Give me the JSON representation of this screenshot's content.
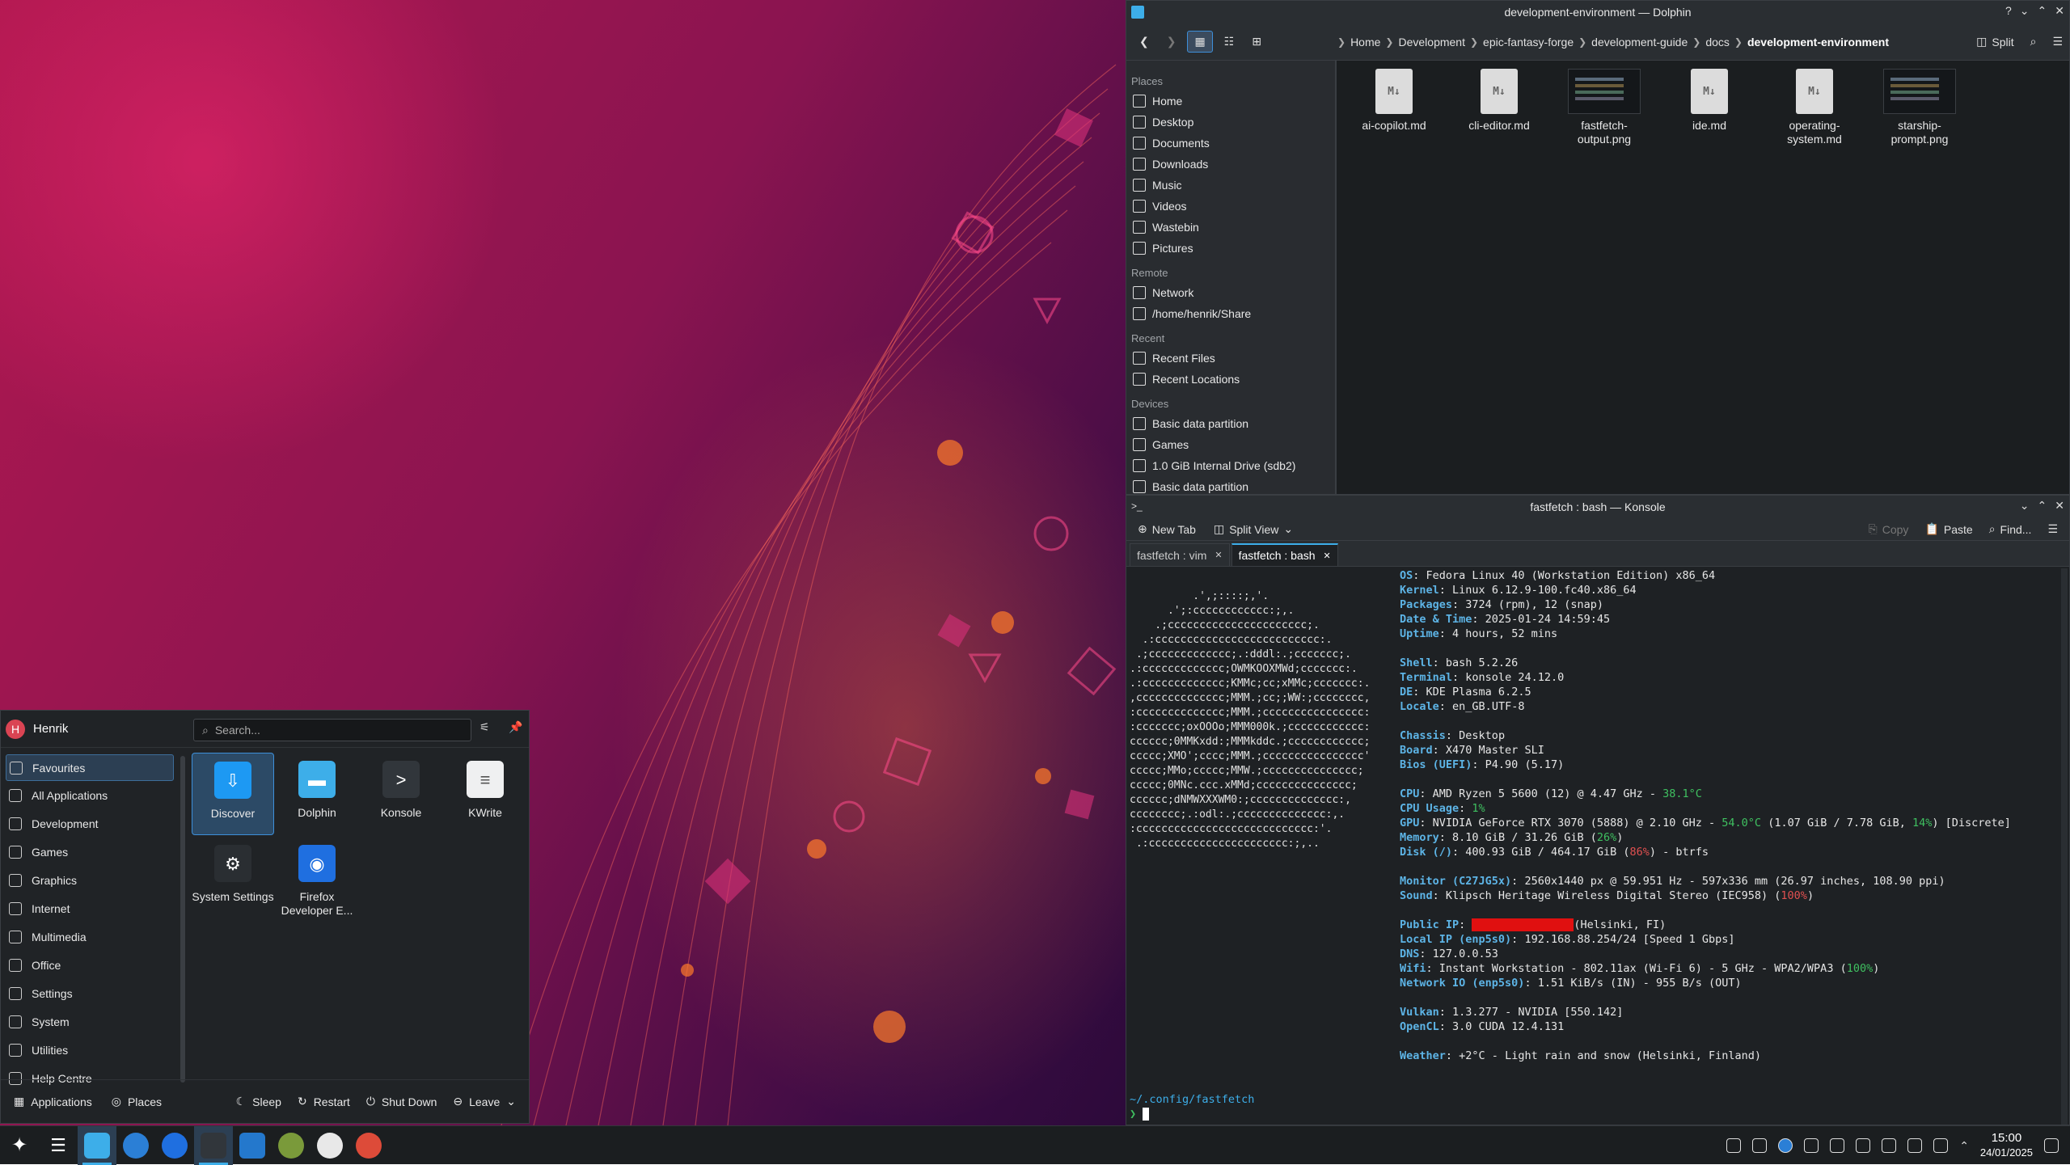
{
  "dolphin": {
    "title": "development-environment — Dolphin",
    "breadcrumb": [
      "Home",
      "Development",
      "epic-fantasy-forge",
      "development-guide",
      "docs",
      "development-environment"
    ],
    "split_label": "Split",
    "places": {
      "section_places": "Places",
      "places": [
        "Home",
        "Desktop",
        "Documents",
        "Downloads",
        "Music",
        "Videos",
        "Wastebin",
        "Pictures"
      ],
      "section_remote": "Remote",
      "remote": [
        "Network",
        "/home/henrik/Share"
      ],
      "section_recent": "Recent",
      "recent": [
        "Recent Files",
        "Recent Locations"
      ],
      "section_devices": "Devices",
      "devices": [
        "Basic data partition",
        "Games",
        "1.0 GiB Internal Drive (sdb2)",
        "Basic data partition"
      ]
    },
    "files": [
      {
        "name": "ai-copilot.md",
        "kind": "md"
      },
      {
        "name": "cli-editor.md",
        "kind": "md"
      },
      {
        "name": "fastfetch-output.png",
        "kind": "png"
      },
      {
        "name": "ide.md",
        "kind": "md"
      },
      {
        "name": "operating-system.md",
        "kind": "md"
      },
      {
        "name": "starship-prompt.png",
        "kind": "png"
      }
    ],
    "md_badge": "M↓"
  },
  "konsole": {
    "title": "fastfetch : bash — Konsole",
    "new_tab": "New Tab",
    "split_view": "Split View",
    "copy": "Copy",
    "paste": "Paste",
    "find": "Find...",
    "tabs": [
      "fastfetch : vim",
      "fastfetch : bash"
    ],
    "ascii": "          .',;::::;,'.\n      .';:cccccccccccc:;,.\n    .;cccccccccccccccccccccc;.\n  .:cccccccccccccccccccccccccc:.\n .;ccccccccccccc;.:dddl:.;ccccccc;.\n.:ccccccccccccc;OWMKOOXMWd;ccccccc:.\n.:ccccccccccccc;KMMc;cc;xMMc;ccccccc:.\n,cccccccccccccc;MMM.;cc;;WW:;cccccccc,\n:cccccccccccccc;MMM.;cccccccccccccccc:\n:ccccccc;oxOOOo;MMM000k.;cccccccccccc:\ncccccc;0MMKxdd:;MMMkddc.;cccccccccccc;\nccccc;XMO';cccc;MMM.;cccccccccccccccc'\nccccc;MMo;ccccc;MMW.;ccccccccccccccc;\nccccc;0MNc.ccc.xMMd;ccccccccccccccc;\ncccccc;dNMWXXXWM0:;cccccccccccccc:,\ncccccccc;.:odl:.;cccccccccccccc:,.\n:cccccccccccccccccccccccccccc:'.\n .:cccccccccccccccccccccc:;,..",
    "info": [
      [
        [
          "k",
          "OS"
        ],
        [
          "",
          "Fedora Linux 40 (Workstation Edition) x86_64"
        ]
      ],
      [
        [
          "k",
          "Kernel"
        ],
        [
          "",
          "Linux 6.12.9-100.fc40.x86_64"
        ]
      ],
      [
        [
          "k",
          "Packages"
        ],
        [
          "",
          "3724 (rpm), 12 (snap)"
        ]
      ],
      [
        [
          "k",
          "Date & Time"
        ],
        [
          "",
          "2025-01-24 14:59:45"
        ]
      ],
      [
        [
          "k",
          "Uptime"
        ],
        [
          "",
          "4 hours, 52 mins"
        ]
      ],
      [],
      [
        [
          "k",
          "Shell"
        ],
        [
          "",
          "bash 5.2.26"
        ]
      ],
      [
        [
          "k",
          "Terminal"
        ],
        [
          "",
          "konsole 24.12.0"
        ]
      ],
      [
        [
          "k",
          "DE"
        ],
        [
          "",
          "KDE Plasma 6.2.5"
        ]
      ],
      [
        [
          "k",
          "Locale"
        ],
        [
          "",
          "en_GB.UTF-8"
        ]
      ],
      [],
      [
        [
          "k",
          "Chassis"
        ],
        [
          "",
          "Desktop"
        ]
      ],
      [
        [
          "k",
          "Board"
        ],
        [
          "",
          "X470 Master SLI"
        ]
      ],
      [
        [
          "k",
          "Bios (UEFI)"
        ],
        [
          "",
          "P4.90 (5.17)"
        ]
      ],
      [],
      [
        [
          "k",
          "CPU"
        ],
        [
          "",
          "AMD Ryzen 5 5600 (12) @ 4.47 GHz - "
        ],
        [
          "g",
          "38.1°C"
        ]
      ],
      [
        [
          "k",
          "CPU Usage"
        ],
        [
          "g",
          "1%"
        ]
      ],
      [
        [
          "k",
          "GPU"
        ],
        [
          "",
          "NVIDIA GeForce RTX 3070 (5888) @ 2.10 GHz - "
        ],
        [
          "g",
          "54.0°C"
        ],
        [
          "",
          " (1.07 GiB / 7.78 GiB, "
        ],
        [
          "g",
          "14%"
        ],
        [
          "",
          ") [Discrete]"
        ]
      ],
      [
        [
          "k",
          "Memory"
        ],
        [
          "",
          "8.10 GiB / 31.26 GiB ("
        ],
        [
          "g",
          "26%"
        ],
        [
          "",
          ")"
        ]
      ],
      [
        [
          "k",
          "Disk (/)"
        ],
        [
          "",
          "400.93 GiB / 464.17 GiB ("
        ],
        [
          "r",
          "86%"
        ],
        [
          "",
          ") - btrfs"
        ]
      ],
      [],
      [
        [
          "k",
          "Monitor (C27JG5x)"
        ],
        [
          "",
          "2560x1440 px @ 59.951 Hz - 597x336 mm (26.97 inches, 108.90 ppi)"
        ]
      ],
      [
        [
          "k",
          "Sound"
        ],
        [
          "",
          "Klipsch Heritage Wireless Digital Stereo (IEC958) ("
        ],
        [
          "r",
          "100%"
        ],
        [
          "",
          ")"
        ]
      ],
      [],
      [
        [
          "k",
          "Public IP"
        ],
        [
          "redact",
          ""
        ],
        [
          "",
          "(Helsinki, FI)"
        ]
      ],
      [
        [
          "k",
          "Local IP (enp5s0)"
        ],
        [
          "",
          "192.168.88.254/24 [Speed 1 Gbps]"
        ]
      ],
      [
        [
          "k",
          "DNS"
        ],
        [
          "",
          "127.0.0.53"
        ]
      ],
      [
        [
          "k",
          "Wifi"
        ],
        [
          "",
          "Instant Workstation - 802.11ax (Wi-Fi 6) - 5 GHz - WPA2/WPA3 ("
        ],
        [
          "g",
          "100%"
        ],
        [
          "",
          ")"
        ]
      ],
      [
        [
          "k",
          "Network IO (enp5s0)"
        ],
        [
          "",
          "1.51 KiB/s (IN) - 955 B/s (OUT)"
        ]
      ],
      [],
      [
        [
          "k",
          "Vulkan"
        ],
        [
          "",
          "1.3.277 - NVIDIA [550.142]"
        ]
      ],
      [
        [
          "k",
          "OpenCL"
        ],
        [
          "",
          "3.0 CUDA 12.4.131"
        ]
      ],
      [],
      [
        [
          "k",
          "Weather"
        ],
        [
          "",
          "+2°C - Light rain and snow (Helsinki, Finland)"
        ]
      ]
    ],
    "prompt_path": "~/.config/fastfetch",
    "prompt_arrow": "❯"
  },
  "menu": {
    "user": "Henrik",
    "user_initial": "H",
    "search_placeholder": "Search...",
    "categories": [
      "Favourites",
      "All Applications",
      "Development",
      "Games",
      "Graphics",
      "Internet",
      "Multimedia",
      "Office",
      "Settings",
      "System",
      "Utilities",
      "Help Centre"
    ],
    "apps": [
      {
        "name": "Discover",
        "color": "#1d99f3"
      },
      {
        "name": "Dolphin",
        "color": "#3daee9"
      },
      {
        "name": "Konsole",
        "color": "#31363b"
      },
      {
        "name": "KWrite",
        "color": "#eff0f1"
      },
      {
        "name": "System Settings",
        "color": "#2a2e32"
      },
      {
        "name": "Firefox Developer E...",
        "color": "#1f6fe0"
      }
    ],
    "footer": {
      "applications": "Applications",
      "places": "Places",
      "sleep": "Sleep",
      "restart": "Restart",
      "shutdown": "Shut Down",
      "leave": "Leave"
    }
  },
  "panel": {
    "clock_time": "15:00",
    "clock_date": "24/01/2025",
    "tasks": [
      "#3daee9",
      "#2b7fd6",
      "#1f6fe0",
      "#31363b",
      "#2478cc",
      "#7a9a3a",
      "#e8e8e8",
      "#dd4b39"
    ]
  }
}
